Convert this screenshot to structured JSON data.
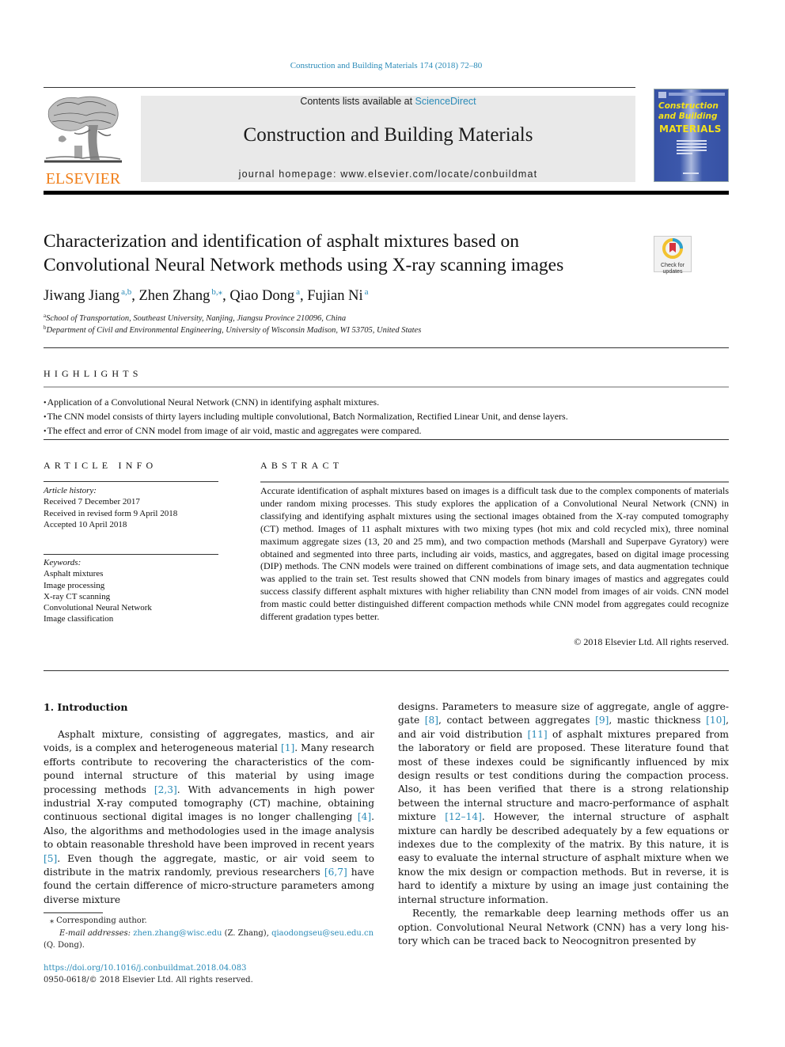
{
  "running_header": "Construction and Building Materials 174 (2018) 72–80",
  "masthead": {
    "publisher_logo_text": "ELSEVIER",
    "contents_prefix": "Contents lists available at ",
    "contents_link": "ScienceDirect",
    "journal_title": "Construction and Building Materials",
    "homepage_line": "journal homepage: www.elsevier.com/locate/conbuildmat",
    "cover": {
      "line1": "Construction",
      "line2": "and Building",
      "line3": "MATERIALS"
    },
    "colors": {
      "link_blue": "#2a8bb8",
      "elsevier_orange": "#f07f1a",
      "cover_blue": "#3651a4",
      "cover_yellow": "#f4e11c",
      "masthead_gray": "#e9e9e9"
    }
  },
  "article": {
    "title_line1": "Characterization and identification of asphalt mixtures based on",
    "title_line2": "Convolutional Neural Network methods using X-ray scanning images",
    "check_updates_line1": "Check for",
    "check_updates_line2": "updates",
    "authors": [
      {
        "name": "Jiwang Jiang",
        "affil": "a,b",
        "sep": ", "
      },
      {
        "name": "Zhen Zhang",
        "affil": "b,⁎",
        "sep": ", "
      },
      {
        "name": "Qiao Dong",
        "affil": "a",
        "sep": ", "
      },
      {
        "name": "Fujian Ni",
        "affil": "a",
        "sep": ""
      }
    ],
    "affiliations": [
      {
        "mark": "a",
        "text": "School of Transportation, Southeast University, Nanjing, Jiangsu Province 210096, China"
      },
      {
        "mark": "b",
        "text": "Department of Civil and Environmental Engineering, University of Wisconsin Madison, WI 53705, United States"
      }
    ]
  },
  "highlights": {
    "heading": "HIGHLIGHTS",
    "items": [
      "Application of a Convolutional Neural Network (CNN) in identifying asphalt mixtures.",
      "The CNN model consists of thirty layers including multiple convolutional, Batch Normalization, Rectified Linear Unit, and dense layers.",
      "The effect and error of CNN model from image of air void, mastic and aggregates were compared."
    ]
  },
  "article_info": {
    "heading": "ARTICLE INFO",
    "history_label": "Article history:",
    "history": [
      "Received 7 December 2017",
      "Received in revised form 9 April 2018",
      "Accepted 10 April 2018"
    ],
    "keywords_label": "Keywords:",
    "keywords": [
      "Asphalt mixtures",
      "Image processing",
      "X-ray CT scanning",
      "Convolutional Neural Network",
      "Image classification"
    ]
  },
  "abstract": {
    "heading": "ABSTRACT",
    "text": "Accurate identification of asphalt mixtures based on images is a difficult task due to the complex com­ponents of materials under random mixing processes. This study explores the application of a Convolutional Neural Network (CNN) in classifying and identifying asphalt mixtures using the sectional images obtained from the X-ray computed tomography (CT) method. Images of 11 asphalt mixtures with two mixing types (hot mix and cold recycled mix), three nominal maximum aggregate sizes (13, 20 and 25 mm), and two compaction methods (Marshall and Superpave Gyratory) were obtained and segmented into three parts, including air voids, mastics, and aggregates, based on digital image processing (DIP) methods. The CNN models were trained on different combinations of image sets, and data augmentation technique was applied to the train set. Test results showed that CNN models from binary images of mas­tics and aggregates could success classify different asphalt mixtures with higher reliability than CNN model from images of air voids. CNN model from mastic could better distinguished different compaction methods while CNN model from aggregates could recognize different gradation types better.",
    "copyright": "© 2018 Elsevier Ltd. All rights reserved."
  },
  "introduction": {
    "heading": "1. Introduction",
    "left_para": [
      {
        "t": "Asphalt mixture, consisting of aggregates, mastics, and air voids, is a complex and heterogeneous material "
      },
      {
        "r": "[1]"
      },
      {
        "t": ". Many research efforts contribute to recovering the characteristics of the com­pound internal structure of this material by using image processing methods "
      },
      {
        "r": "[2,3]"
      },
      {
        "t": ". With advancements in high power industrial X-ray computed tomography (CT) machine, obtaining continuous sec­tional digital images is no longer challenging "
      },
      {
        "r": "[4]"
      },
      {
        "t": ". Also, the algo­rithms and methodologies used in the image analysis to obtain reasonable threshold have been improved in recent years "
      },
      {
        "r": "[5]"
      },
      {
        "t": ". Even though the aggregate, mastic, or air void seem to distribute in the matrix randomly, previous researchers "
      },
      {
        "r": "[6,7]"
      },
      {
        "t": " have found the certain difference of micro-structure parameters among diverse mixture"
      }
    ],
    "right_para1": [
      {
        "t": "designs. Parameters to measure size of aggregate, angle of aggre­gate "
      },
      {
        "r": "[8]"
      },
      {
        "t": ", contact between aggregates "
      },
      {
        "r": "[9]"
      },
      {
        "t": ", mastic thickness "
      },
      {
        "r": "[10]"
      },
      {
        "t": ", and air void distribution "
      },
      {
        "r": "[11]"
      },
      {
        "t": " of asphalt mixtures prepared from the laboratory or field are proposed. These literature found that most of these indexes could be significantly influenced by mix design results or test conditions during the compaction process. Also, it has been verified that there is a strong relationship between the internal structure and macro-performance of asphalt mixture "
      },
      {
        "r": "[12–14]"
      },
      {
        "t": ". However, the internal structure of asphalt mixture can hardly be described adequately by a few equations or indexes due to the complexity of the matrix. By this nature, it is easy to evaluate the internal structure of asphalt mixture when we know the mix design or compaction methods. But in reverse, it is hard to identify a mixture by using an image just containing the internal structure information."
      }
    ],
    "right_para2": "Recently, the remarkable deep learning methods offer us an option. Convolutional Neural Network (CNN) has a very long his­tory which can be traced back to Neocognitron presented by"
  },
  "footnotes": {
    "corresponding": "⁎ Corresponding author.",
    "email_label": "E-mail addresses:",
    "email1": "zhen.zhang@wisc.edu",
    "email1_owner": " (Z. Zhang), ",
    "email2": "qiaodongseu@seu.edu.cn",
    "email2_owner": "(Q. Dong).",
    "doi": "https://doi.org/10.1016/j.conbuildmat.2018.04.083",
    "issn": "0950-0618/© 2018 Elsevier Ltd. All rights reserved."
  }
}
